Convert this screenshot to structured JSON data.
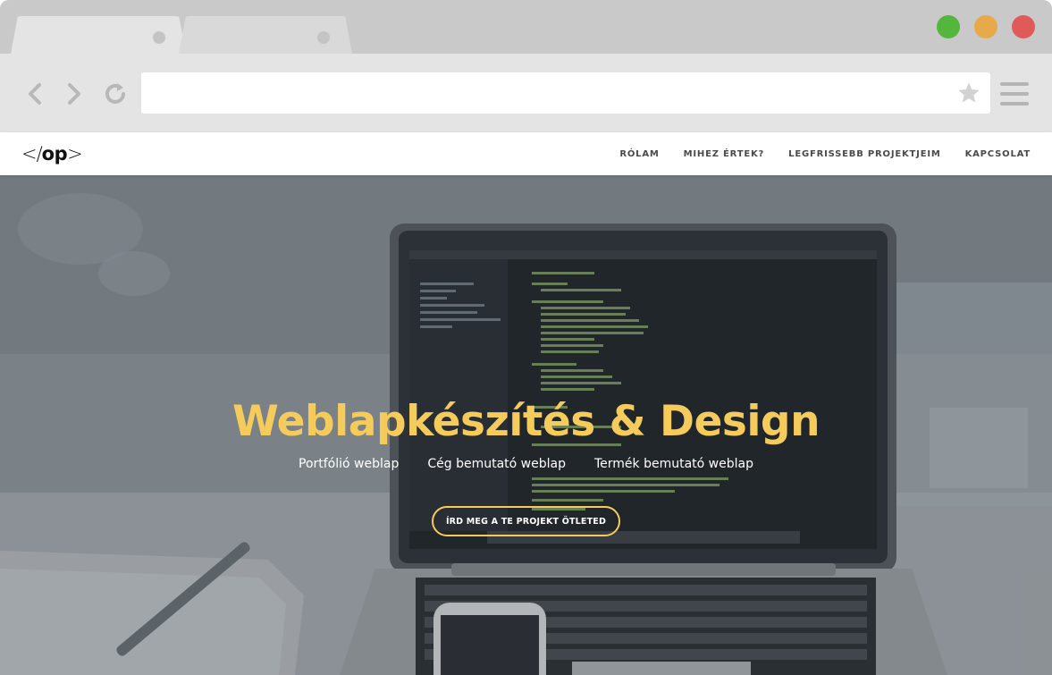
{
  "browser": {
    "address_value": "",
    "icons": {
      "back": "chevron-left-icon",
      "forward": "chevron-right-icon",
      "reload": "reload-icon",
      "bookmark": "star-icon",
      "menu": "hamburger-menu-icon"
    },
    "window_buttons": [
      {
        "name": "maximize",
        "color": "#55b63d"
      },
      {
        "name": "minimize",
        "color": "#e6aa4b"
      },
      {
        "name": "close",
        "color": "#e05a5a"
      }
    ]
  },
  "site": {
    "logo": {
      "slash_part": "</",
      "text_part": "op",
      "tail_part": ">"
    },
    "nav": [
      {
        "label": "RÓLAM"
      },
      {
        "label": "MIHEZ ÉRTEK?"
      },
      {
        "label": "LEGFRISSEBB PROJEKTJEIM"
      },
      {
        "label": "KAPCSOLAT"
      }
    ],
    "hero": {
      "title": "Weblapkészítés & Design",
      "subtitles": [
        "Portfólió weblap",
        "Cég bemutató weblap",
        "Termék bemutató weblap"
      ],
      "cta_label": "ÍRD MEG A TE PROJEKT ÖTLETED"
    }
  },
  "colors": {
    "accent_yellow": "#f5cb5c",
    "nav_text": "#4a4a4a",
    "chrome_bg": "#e4e4e4",
    "tabbar_bg": "#c9c9c9"
  }
}
